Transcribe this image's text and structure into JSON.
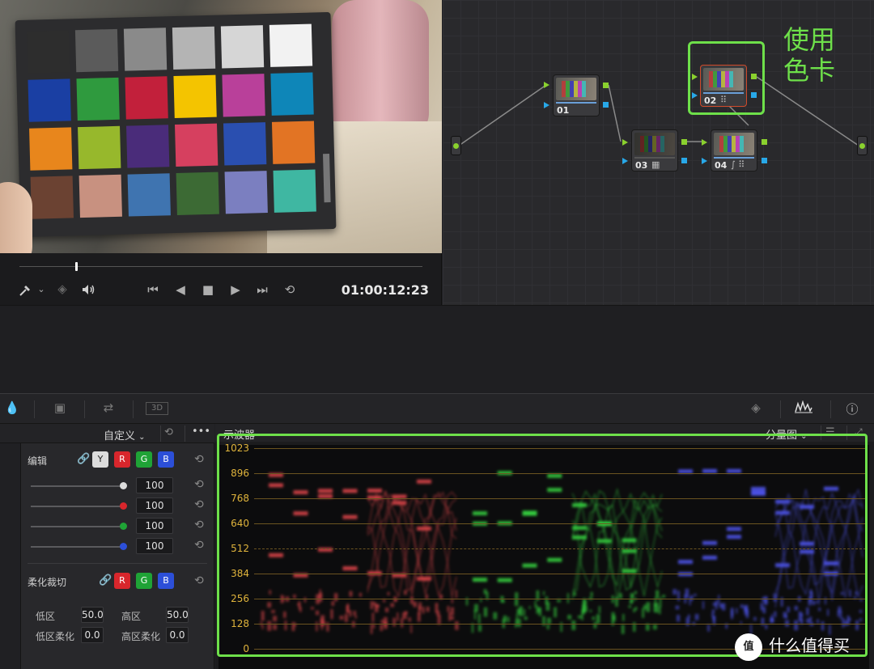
{
  "viewer": {
    "timecode": "01:00:12:23",
    "scrub_position_fraction": 0.14,
    "checker_patches": [
      "#2d2d2d",
      "#5b5b5b",
      "#8a8a8a",
      "#b4b4b4",
      "#d6d6d6",
      "#f2f2f2",
      "#1a3fa3",
      "#2f9a3e",
      "#c2203b",
      "#f4c400",
      "#b9409a",
      "#0e86b8",
      "#e8861c",
      "#97b82c",
      "#4a2c7a",
      "#d6405f",
      "#2a4fb0",
      "#e27424",
      "#6b4232",
      "#c89180",
      "#3f74b0",
      "#3c6a34",
      "#7b7fc0",
      "#3fb7a2"
    ],
    "controls": {
      "picker_icon": "eyedropper-icon",
      "layers_icon": "layers-icon",
      "audio_icon": "speaker-icon",
      "first_icon": "skip-to-start-icon",
      "reverse_icon": "play-reverse-icon",
      "stop_icon": "stop-icon",
      "play_icon": "play-icon",
      "last_icon": "skip-to-end-icon",
      "loop_icon": "loop-icon"
    }
  },
  "nodes": [
    {
      "id": "node-01",
      "label": "01",
      "icon": ""
    },
    {
      "id": "node-02",
      "label": "02",
      "icon": "⠿"
    },
    {
      "id": "node-03",
      "label": "03",
      "icon": "▦"
    },
    {
      "id": "node-04",
      "label": "04",
      "icon": "∫ ⠿"
    }
  ],
  "annotation": {
    "line1": "使用",
    "line2": "色卡"
  },
  "left_panel": {
    "preset": "自定义",
    "edit_label": "编辑",
    "channels": [
      "Y",
      "R",
      "G",
      "B"
    ],
    "slider_values": [
      "100",
      "100",
      "100",
      "100"
    ],
    "soft_clip_label": "柔化裁切",
    "soft_channels": [
      "R",
      "G",
      "B"
    ],
    "low_label": "低区",
    "low_value": "50.0",
    "high_label": "高区",
    "high_value": "50.0",
    "low_soft_label": "低区柔化",
    "low_soft_value": "0.0",
    "high_soft_label": "高区柔化",
    "high_soft_value": "0.0"
  },
  "scope": {
    "title": "示波器",
    "mode": "分量图",
    "y_labels": [
      "1023",
      "896",
      "768",
      "640",
      "512",
      "384",
      "256",
      "128",
      "0"
    ]
  },
  "watermark": {
    "logo": "值",
    "text": "什么值得买"
  },
  "colors": {
    "accent_green": "#6ee04a",
    "node_port_green": "#8ad12e",
    "node_port_blue": "#28a8e8"
  }
}
